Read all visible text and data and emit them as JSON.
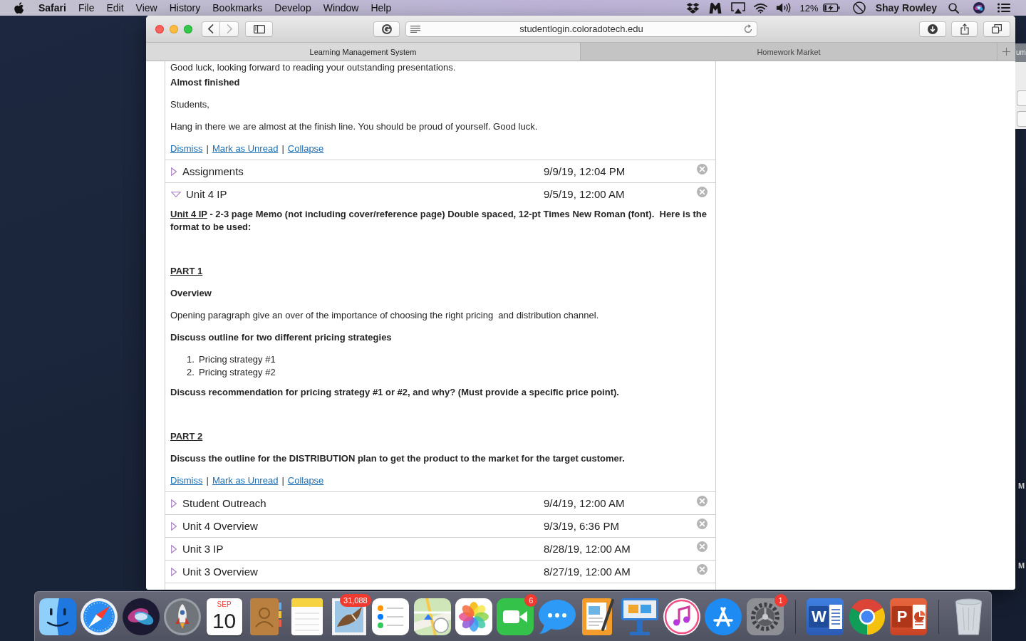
{
  "menu_bar": {
    "app_name": "Safari",
    "menus": [
      "File",
      "Edit",
      "View",
      "History",
      "Bookmarks",
      "Develop",
      "Window",
      "Help"
    ],
    "battery": "12%",
    "user": "Shay Rowley"
  },
  "browser": {
    "back_disabled": false,
    "forward_disabled": true,
    "url": "studentlogin.coloradotech.edu",
    "tabs": [
      {
        "label": "Learning Management System",
        "selected": true
      },
      {
        "label": "Homework Market",
        "selected": false
      }
    ]
  },
  "announcement_tail": {
    "blocks": [
      {
        "kind": "paragraph",
        "text": "Good luck, looking forward to reading your outstanding presentations."
      },
      {
        "kind": "bold",
        "text": "Almost finished"
      },
      {
        "kind": "paragraph",
        "text": "Students,"
      },
      {
        "kind": "paragraph",
        "text": "Hang in there we are almost at the finish line. You should be proud of yourself. Good luck."
      }
    ],
    "actions": {
      "links": [
        "Dismiss",
        "Mark as Unread",
        "Collapse"
      ],
      "separator": "|"
    }
  },
  "items": [
    {
      "title": "Assignments",
      "date": "9/9/19, 12:04 PM",
      "expanded": false
    },
    {
      "title": "Unit 4 IP",
      "date": "9/5/19, 12:00 AM",
      "expanded": true,
      "blocks": [
        {
          "kind": "lead",
          "label": "Unit 4 IP",
          "text": "- 2-3 page Memo (not including cover/reference page) Double spaced, 12-pt Times New Roman (font).  Here is the format to be used:"
        },
        {
          "kind": "section",
          "text": "PART 1"
        },
        {
          "kind": "bold",
          "text": "Overview"
        },
        {
          "kind": "paragraph",
          "text": "Opening paragraph give an over of the importance of choosing the right pricing  and distribution channel."
        },
        {
          "kind": "bold",
          "text": "Discuss outline for two different pricing strategies"
        },
        {
          "kind": "list",
          "items": [
            {
              "number": "1.",
              "text": "Pricing strategy #1"
            },
            {
              "number": "2.",
              "text": "Pricing strategy #2"
            }
          ]
        },
        {
          "kind": "bold",
          "text": "Discuss recommendation for pricing strategy #1 or #2, and why? (Must provide a specific price point)."
        },
        {
          "kind": "section",
          "text": "PART 2"
        },
        {
          "kind": "bold",
          "text": "Discuss the outline for the DISTRIBUTION plan to get the product to the market for the target customer."
        }
      ],
      "actions": {
        "links": [
          "Dismiss",
          "Mark as Unread",
          "Collapse"
        ],
        "separator": "|"
      }
    },
    {
      "title": "Student Outreach",
      "date": "9/4/19, 12:00 AM",
      "expanded": false
    },
    {
      "title": "Unit 4 Overview",
      "date": "9/3/19, 6:36 PM",
      "expanded": false
    },
    {
      "title": "Unit 3 IP",
      "date": "8/28/19, 12:00 AM",
      "expanded": false
    },
    {
      "title": "Unit 3 Overview",
      "date": "8/27/19, 12:00 AM",
      "expanded": false
    }
  ],
  "background_window": {
    "title_fragment": "um"
  },
  "desktop": {
    "edge_labels": [
      "M",
      "M"
    ]
  },
  "dock": {
    "items": [
      {
        "kind": "finder"
      },
      {
        "kind": "safari"
      },
      {
        "kind": "siri"
      },
      {
        "kind": "launchpad"
      },
      {
        "kind": "calendar",
        "month": "SEP",
        "day": "10"
      },
      {
        "kind": "contacts"
      },
      {
        "kind": "notes"
      },
      {
        "kind": "mail",
        "badge": "31,088"
      },
      {
        "kind": "reminders"
      },
      {
        "kind": "maps"
      },
      {
        "kind": "photos"
      },
      {
        "kind": "facetime",
        "badge": "6"
      },
      {
        "kind": "messages"
      },
      {
        "kind": "pages"
      },
      {
        "kind": "keynote"
      },
      {
        "kind": "music"
      },
      {
        "kind": "appstore"
      },
      {
        "kind": "settings",
        "badge": "1"
      },
      {
        "kind": "separator"
      },
      {
        "kind": "word",
        "letter": "W"
      },
      {
        "kind": "chrome"
      },
      {
        "kind": "powerpoint",
        "letter": "P"
      },
      {
        "kind": "separator"
      },
      {
        "kind": "trash"
      }
    ]
  }
}
